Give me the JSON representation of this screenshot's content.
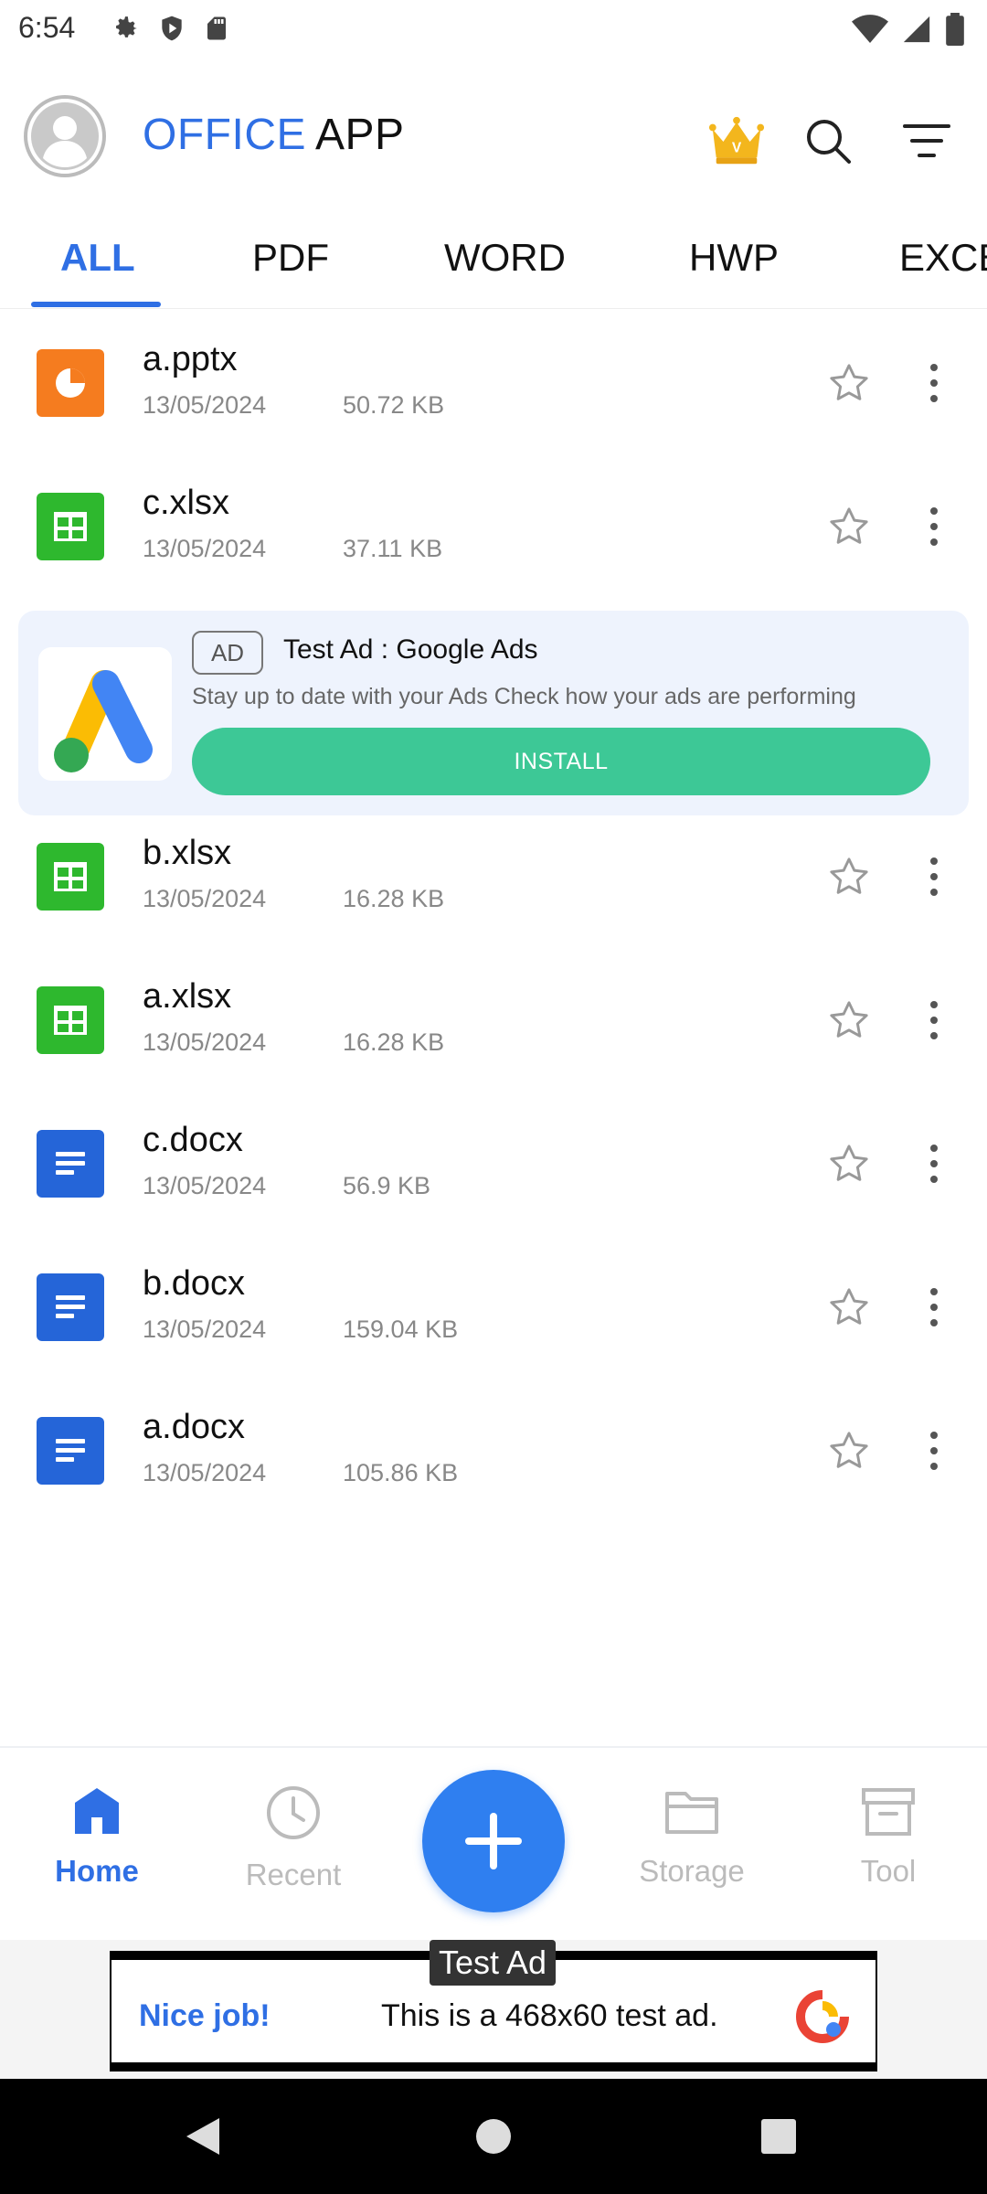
{
  "status_bar": {
    "time": "6:54"
  },
  "header": {
    "title_part1": "OFFICE",
    "title_part2": "APP",
    "icons": [
      "crown-icon",
      "search-icon",
      "filter-icon"
    ]
  },
  "tabs": [
    {
      "label": "ALL",
      "active": true
    },
    {
      "label": "PDF",
      "active": false
    },
    {
      "label": "WORD",
      "active": false
    },
    {
      "label": "HWP",
      "active": false
    },
    {
      "label": "EXCEL",
      "active": false
    }
  ],
  "files": [
    {
      "name": "a.pptx",
      "date": "13/05/2024",
      "size": "50.72 KB",
      "type": "pptx",
      "color": "#f57c1f"
    },
    {
      "name": "c.xlsx",
      "date": "13/05/2024",
      "size": "37.11 KB",
      "type": "xlsx",
      "color": "#2eb82e"
    },
    {
      "name": "b.xlsx",
      "date": "13/05/2024",
      "size": "16.28 KB",
      "type": "xlsx",
      "color": "#2eb82e"
    },
    {
      "name": "a.xlsx",
      "date": "13/05/2024",
      "size": "16.28 KB",
      "type": "xlsx",
      "color": "#2eb82e"
    },
    {
      "name": "c.docx",
      "date": "13/05/2024",
      "size": "56.9 KB",
      "type": "docx",
      "color": "#2565d8"
    },
    {
      "name": "b.docx",
      "date": "13/05/2024",
      "size": "159.04 KB",
      "type": "docx",
      "color": "#2565d8"
    },
    {
      "name": "a.docx",
      "date": "13/05/2024",
      "size": "105.86 KB",
      "type": "docx",
      "color": "#2565d8"
    }
  ],
  "native_ad": {
    "badge": "AD",
    "title": "Test Ad : Google Ads",
    "description": "Stay up to date with your Ads Check how your ads are performing",
    "button": "INSTALL"
  },
  "bottom_nav": {
    "items": [
      {
        "label": "Home",
        "icon": "home-icon",
        "active": true
      },
      {
        "label": "Recent",
        "icon": "clock-icon",
        "active": false
      },
      {
        "label": "Storage",
        "icon": "folder-icon",
        "active": false
      },
      {
        "label": "Tool",
        "icon": "archive-icon",
        "active": false
      }
    ],
    "fab_icon": "plus-icon"
  },
  "banner_ad": {
    "tag": "Test Ad",
    "headline": "Nice job!",
    "text": "This is a 468x60 test ad."
  },
  "colors": {
    "accent": "#2f6fe4",
    "install_green": "#3dc896",
    "pptx": "#f57c1f",
    "xlsx": "#2eb82e",
    "docx": "#2565d8"
  }
}
